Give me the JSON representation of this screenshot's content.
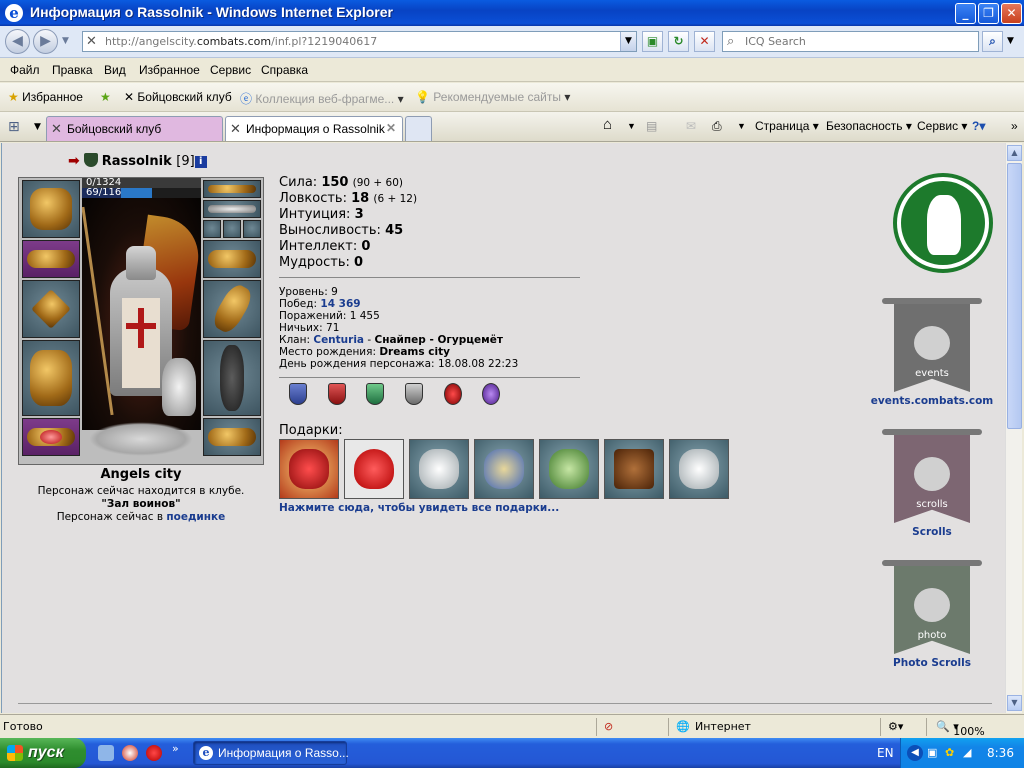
{
  "window": {
    "title": "Информация о Rassolnik - Windows Internet Explorer",
    "buttons": {
      "minimize": "_",
      "maximize": "❐",
      "close": "✕"
    }
  },
  "address": {
    "url_prefix": "http://angelscity.",
    "url_host": "combats.com",
    "url_path": "/inf.pl?1219040617",
    "search_placeholder": "ICQ Search"
  },
  "menu": [
    "Файл",
    "Правка",
    "Вид",
    "Избранное",
    "Сервис",
    "Справка"
  ],
  "favorites": {
    "label": "Избранное",
    "items": [
      "Бойцовский клуб",
      "Коллекция веб-фрагме...",
      "Рекомендуемые сайты"
    ]
  },
  "tabs": [
    {
      "label": "Бойцовский клуб"
    },
    {
      "label": "Информация о Rassolnik"
    }
  ],
  "commands": [
    "Страница",
    "Безопасность",
    "Сервис"
  ],
  "character": {
    "name": "Rassolnik",
    "level": "[9]",
    "info_icon": "i",
    "hp": "0/1324",
    "mana": "69/116",
    "mana_fraction": 0.59,
    "city": "Angels city",
    "loc_line1": "Персонаж сейчас находится в клубе.",
    "loc_room": "\"Зал воинов\"",
    "loc_line3_prefix": "Персонаж сейчас в",
    "loc_line3_link": "поединке"
  },
  "stats": [
    {
      "label": "Сила:",
      "value": "150",
      "extra": "(90 + 60)"
    },
    {
      "label": "Ловкость:",
      "value": "18",
      "extra": "(6 + 12)"
    },
    {
      "label": "Интуиция:",
      "value": "3",
      "extra": ""
    },
    {
      "label": "Выносливость:",
      "value": "45",
      "extra": ""
    },
    {
      "label": "Интеллект:",
      "value": "0",
      "extra": ""
    },
    {
      "label": "Мудрость:",
      "value": "0",
      "extra": ""
    }
  ],
  "details": {
    "level_label": "Уровень:",
    "level": "9",
    "wins_label": "Побед:",
    "wins": "14 369",
    "losses_label": "Поражений:",
    "losses": "1 455",
    "draws_label": "Ничьих:",
    "draws": "71",
    "clan_label": "Клан:",
    "clan": "Centuria",
    "clan_rank": "Снайпер - Огурцемёт",
    "birthplace_label": "Место рождения:",
    "birthplace": "Dreams city",
    "birthday_label": "День рождения персонажа:",
    "birthday": "18.08.08 22:23"
  },
  "gifts": {
    "title": "Подарки:",
    "link": "Нажмите сюда, чтобы увидеть все подарки..."
  },
  "side": {
    "events_label": "events.combats.com",
    "events_word": "events",
    "scrolls_label": "Scrolls",
    "scrolls_word": "scrolls",
    "photo_label": "Photo Scrolls",
    "photo_word": "photo"
  },
  "status": {
    "text": "Готово",
    "zone": "Интернет",
    "zoom": "100%"
  },
  "taskbar": {
    "start": "пуск",
    "item": "Информация о Rasso...",
    "lang": "EN",
    "clock": "8:36"
  },
  "colors": {
    "link": "#1a3c8f",
    "titlebar": "#0a4fd6",
    "tab_active_bg": "#ffffff",
    "tab_inactive_bg": "#e0b8e0",
    "medal_green": "#1d7a2c"
  }
}
